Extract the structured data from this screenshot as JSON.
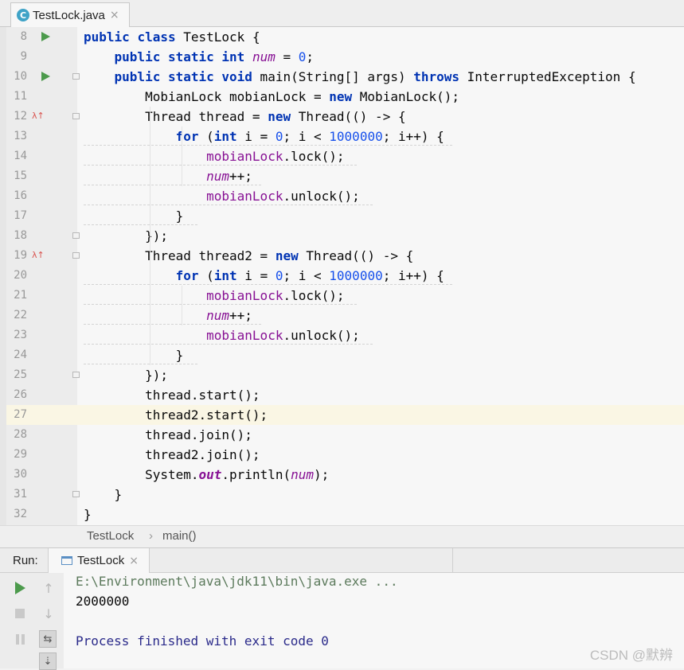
{
  "editor_tab": {
    "icon": "C",
    "filename": "TestLock.java",
    "close": "×"
  },
  "code": {
    "lines": [
      {
        "n": "8",
        "tokens": [
          [
            "kw",
            "public"
          ],
          [
            "",
            " "
          ],
          [
            "kw",
            "class"
          ],
          [
            "",
            " TestLock {"
          ]
        ]
      },
      {
        "n": "9",
        "tokens": [
          [
            "",
            "    "
          ],
          [
            "kw",
            "public static int"
          ],
          [
            "",
            " "
          ],
          [
            "fld",
            "num"
          ],
          [
            "",
            " = "
          ],
          [
            "num",
            "0"
          ],
          [
            "",
            ";"
          ]
        ]
      },
      {
        "n": "10",
        "tokens": [
          [
            "",
            "    "
          ],
          [
            "kw",
            "public static void"
          ],
          [
            "",
            " main(String[] args) "
          ],
          [
            "kw",
            "throws"
          ],
          [
            "",
            " InterruptedException {"
          ]
        ]
      },
      {
        "n": "11",
        "tokens": [
          [
            "",
            "        MobianLock mobianLock = "
          ],
          [
            "kw",
            "new"
          ],
          [
            "",
            " MobianLock();"
          ]
        ]
      },
      {
        "n": "12",
        "tokens": [
          [
            "",
            "        Thread thread = "
          ],
          [
            "kw",
            "new"
          ],
          [
            "",
            " Thread(() -> {"
          ]
        ]
      },
      {
        "n": "13",
        "tokens": [
          [
            "",
            "            "
          ],
          [
            "kw",
            "for"
          ],
          [
            "",
            " ("
          ],
          [
            "kw",
            "int"
          ],
          [
            "",
            " i = "
          ],
          [
            "num",
            "0"
          ],
          [
            "",
            "; i < "
          ],
          [
            "num",
            "1000000"
          ],
          [
            "",
            "; i++) {"
          ]
        ]
      },
      {
        "n": "14",
        "tokens": [
          [
            "",
            "                "
          ],
          [
            "var",
            "mobianLock"
          ],
          [
            "",
            ".lock();"
          ]
        ]
      },
      {
        "n": "15",
        "tokens": [
          [
            "",
            "                "
          ],
          [
            "fld",
            "num"
          ],
          [
            "",
            "++;"
          ]
        ]
      },
      {
        "n": "16",
        "tokens": [
          [
            "",
            "                "
          ],
          [
            "var",
            "mobianLock"
          ],
          [
            "",
            ".unlock();"
          ]
        ]
      },
      {
        "n": "17",
        "tokens": [
          [
            "",
            "            }"
          ]
        ]
      },
      {
        "n": "18",
        "tokens": [
          [
            "",
            "        });"
          ]
        ]
      },
      {
        "n": "19",
        "tokens": [
          [
            "",
            "        Thread thread2 = "
          ],
          [
            "kw",
            "new"
          ],
          [
            "",
            " Thread(() -> {"
          ]
        ]
      },
      {
        "n": "20",
        "tokens": [
          [
            "",
            "            "
          ],
          [
            "kw",
            "for"
          ],
          [
            "",
            " ("
          ],
          [
            "kw",
            "int"
          ],
          [
            "",
            " i = "
          ],
          [
            "num",
            "0"
          ],
          [
            "",
            "; i < "
          ],
          [
            "num",
            "1000000"
          ],
          [
            "",
            "; i++) {"
          ]
        ]
      },
      {
        "n": "21",
        "tokens": [
          [
            "",
            "                "
          ],
          [
            "var",
            "mobianLock"
          ],
          [
            "",
            ".lock();"
          ]
        ]
      },
      {
        "n": "22",
        "tokens": [
          [
            "",
            "                "
          ],
          [
            "fld",
            "num"
          ],
          [
            "",
            "++;"
          ]
        ]
      },
      {
        "n": "23",
        "tokens": [
          [
            "",
            "                "
          ],
          [
            "var",
            "mobianLock"
          ],
          [
            "",
            ".unlock();"
          ]
        ]
      },
      {
        "n": "24",
        "tokens": [
          [
            "",
            "            }"
          ]
        ]
      },
      {
        "n": "25",
        "tokens": [
          [
            "",
            "        });"
          ]
        ]
      },
      {
        "n": "26",
        "tokens": [
          [
            "",
            "        thread.start();"
          ]
        ]
      },
      {
        "n": "27",
        "tokens": [
          [
            "",
            "        thread2.start();"
          ]
        ]
      },
      {
        "n": "28",
        "tokens": [
          [
            "",
            "        thread.join();"
          ]
        ]
      },
      {
        "n": "29",
        "tokens": [
          [
            "",
            "        thread2.join();"
          ]
        ]
      },
      {
        "n": "30",
        "tokens": [
          [
            "",
            "        System."
          ],
          [
            "fldb",
            "out"
          ],
          [
            "",
            ".println("
          ],
          [
            "fld",
            "num"
          ],
          [
            "",
            ");"
          ]
        ]
      },
      {
        "n": "31",
        "tokens": [
          [
            "",
            "    }"
          ]
        ]
      },
      {
        "n": "32",
        "tokens": [
          [
            "",
            "}"
          ]
        ]
      }
    ]
  },
  "breadcrumb": {
    "class_name": "TestLock",
    "separator": "›",
    "method": "main()"
  },
  "run_panel": {
    "label": "Run:",
    "tab_label": "TestLock",
    "tab_close": "×",
    "console_lines": [
      {
        "text": "E:\\Environment\\java\\jdk11\\bin\\java.exe ...",
        "color": "#5c7a5c"
      },
      {
        "text": "2000000",
        "color": "#080808"
      },
      {
        "text": "",
        "color": "#080808"
      },
      {
        "text": "Process finished with exit code 0",
        "color": "#2a2a8a"
      }
    ]
  },
  "watermark": "CSDN @默辨"
}
